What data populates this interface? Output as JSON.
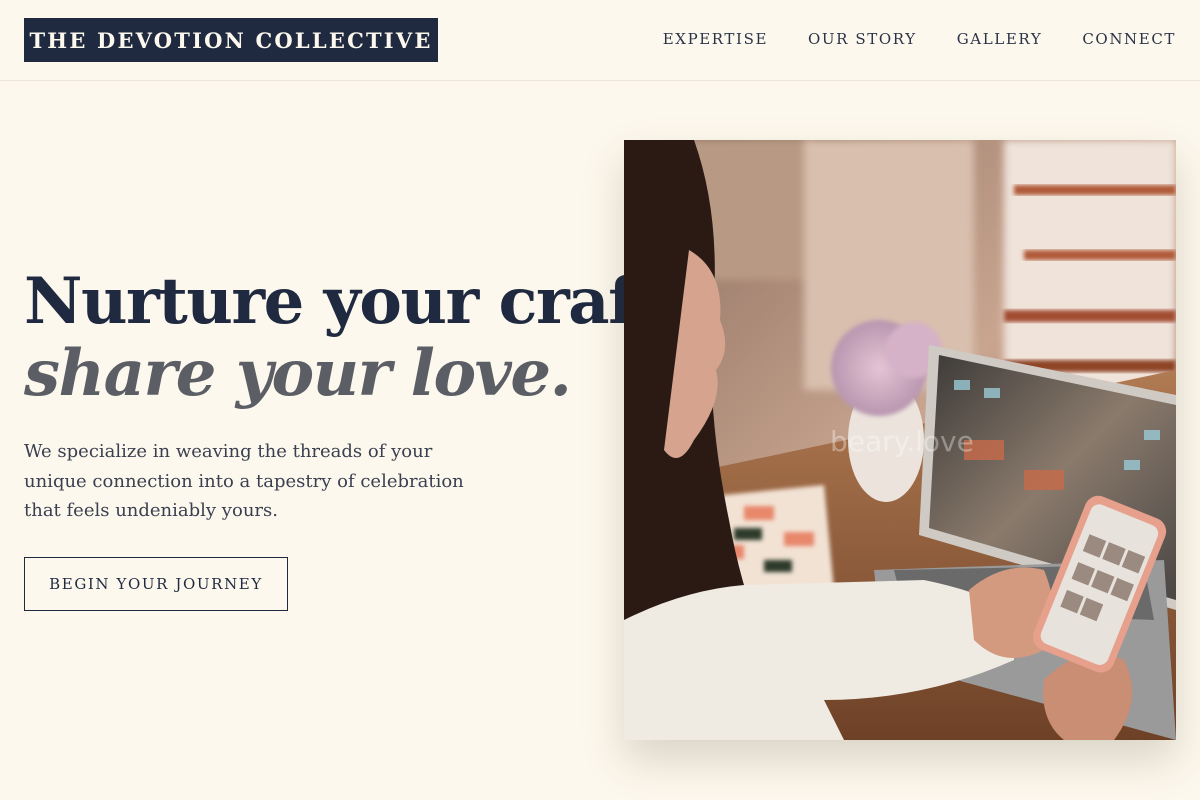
{
  "header": {
    "logo": "THE DEVOTION COLLECTIVE",
    "nav": [
      "EXPERTISE",
      "OUR STORY",
      "GALLERY",
      "CONNECT"
    ]
  },
  "hero": {
    "headline_line1": "Nurture your craft,",
    "headline_line2": "share your love.",
    "description": "We specialize in weaving the threads of your unique connection into a tapestry of celebration that feels undeniably yours.",
    "cta_label": "BEGIN YOUR JOURNEY"
  },
  "photo": {
    "watermark": "beary.love"
  },
  "colors": {
    "background": "#fdf8ed",
    "navy": "#1f2a40",
    "muted": "#5c5e66"
  }
}
